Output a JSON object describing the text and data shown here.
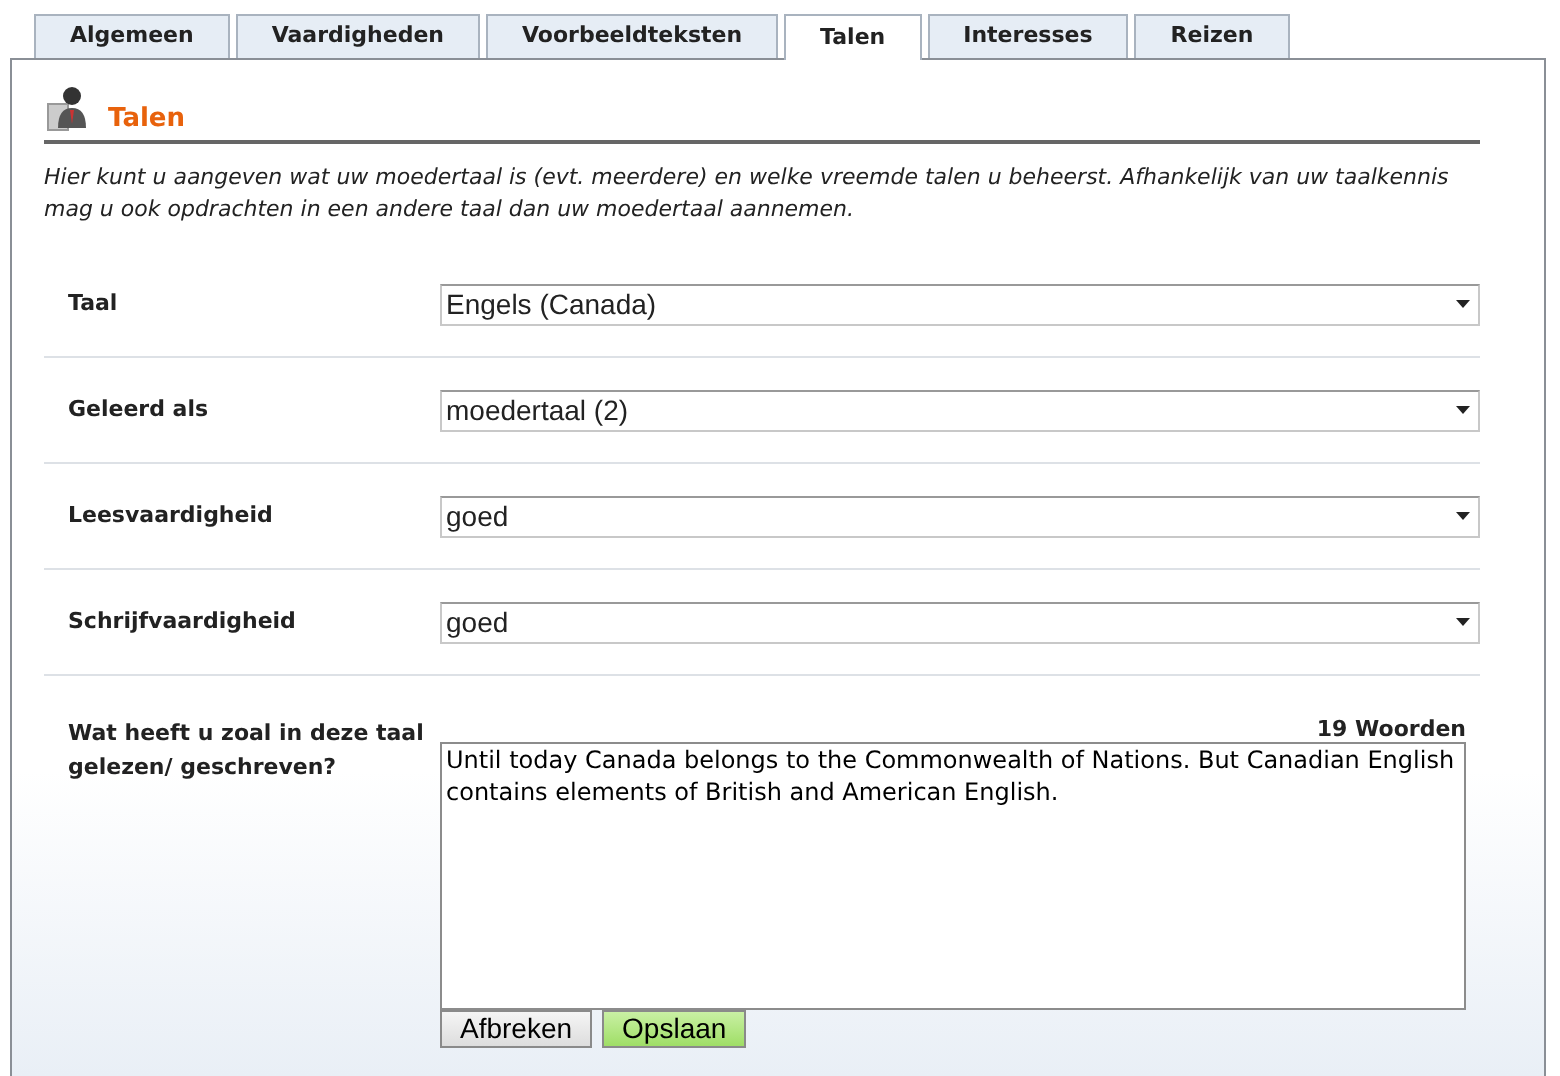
{
  "tabs": [
    {
      "label": "Algemeen",
      "selected": false
    },
    {
      "label": "Vaardigheden",
      "selected": false
    },
    {
      "label": "Voorbeeldteksten",
      "selected": false
    },
    {
      "label": "Talen",
      "selected": true
    },
    {
      "label": "Interesses",
      "selected": false
    },
    {
      "label": "Reizen",
      "selected": false
    }
  ],
  "section": {
    "title": "Talen",
    "description": "Hier kunt u aangeven wat uw moedertaal is (evt. meerdere) en welke vreemde talen u beheerst. Afhankelijk van uw taalkennis mag u ook opdrachten in een andere taal dan uw moedertaal aannemen."
  },
  "fields": [
    {
      "label": "Taal",
      "value": "Engels (Canada)"
    },
    {
      "label": "Geleerd als",
      "value": "moedertaal (2)"
    },
    {
      "label": "Leesvaardigheid",
      "value": "goed"
    },
    {
      "label": "Schrijfvaardigheid",
      "value": "goed"
    }
  ],
  "text_field": {
    "label": "Wat heeft u zoal in deze taal gelezen/ geschreven?",
    "count": "19 Woorden",
    "value": "Until today Canada belongs to the Commonwealth of Nations. But Canadian English contains elements of British and American English."
  },
  "buttons": [
    {
      "label": "Afbreken",
      "kind": "cancel"
    },
    {
      "label": "Opslaan",
      "kind": "save"
    }
  ]
}
